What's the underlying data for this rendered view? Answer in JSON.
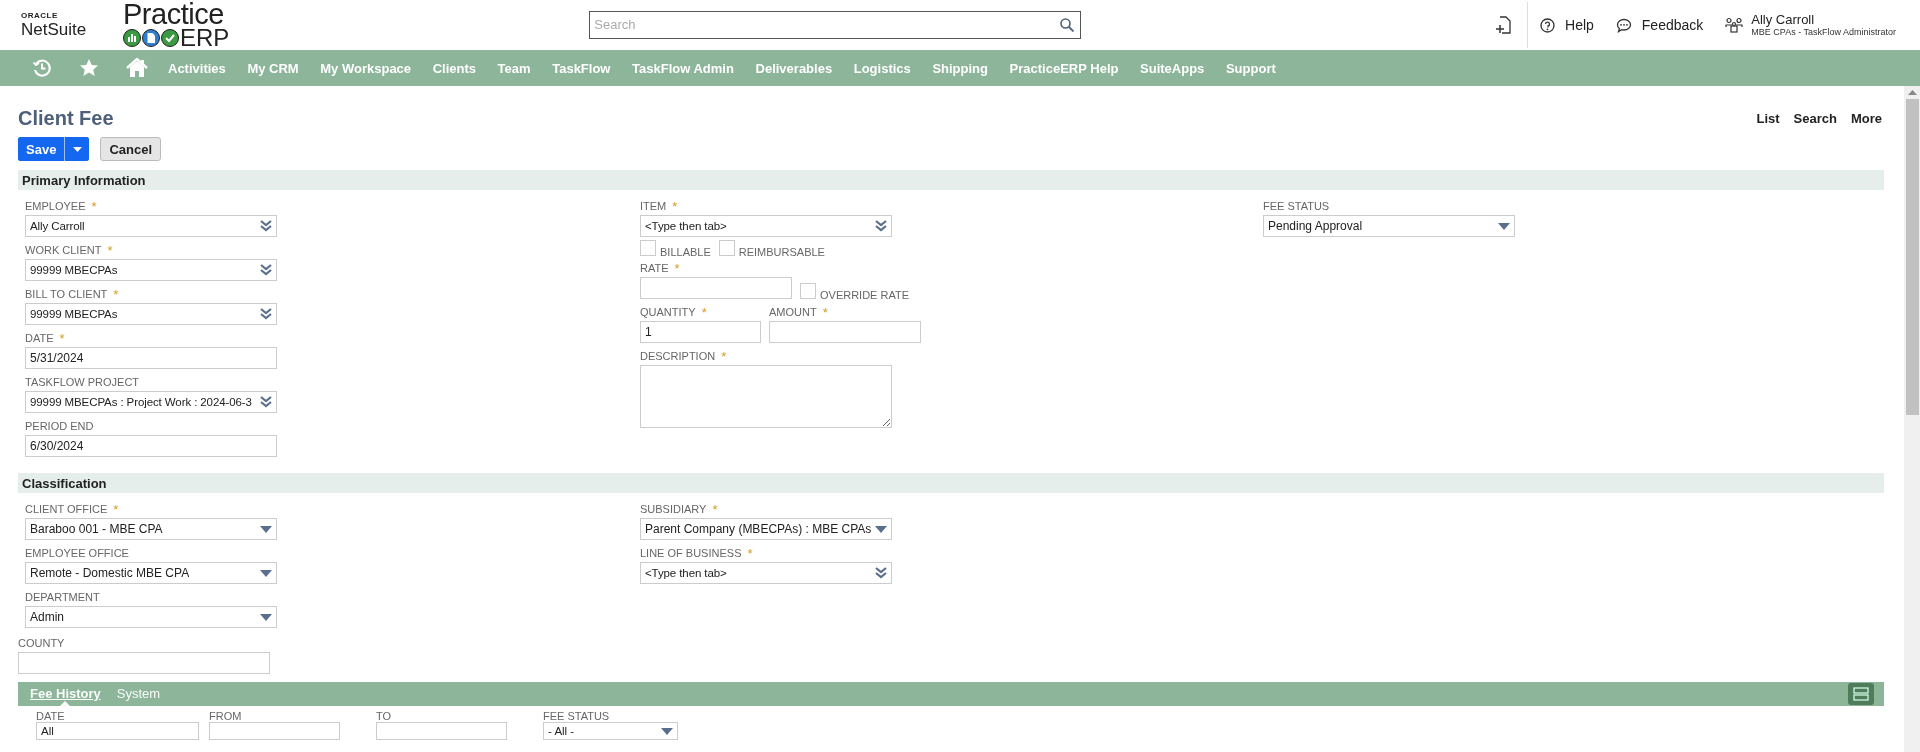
{
  "header": {
    "oracle_logo": {
      "top": "ORACLE",
      "bottom": "NetSuite"
    },
    "app_logo": {
      "first": "Practice",
      "second": "ERP"
    },
    "search": {
      "placeholder": "Search"
    },
    "links": [
      {
        "kind": "help",
        "label": "Help"
      },
      {
        "kind": "feedback",
        "label": "Feedback"
      }
    ],
    "user": {
      "name": "Ally Carroll",
      "role": "MBE CPAs - TaskFlow Administrator"
    }
  },
  "nav": {
    "icons": [
      {
        "kind": "recent"
      },
      {
        "kind": "star"
      },
      {
        "kind": "home"
      }
    ],
    "items": [
      "Activities",
      "My CRM",
      "My Workspace",
      "Clients",
      "Team",
      "TaskFlow",
      "TaskFlow Admin",
      "Deliverables",
      "Logistics",
      "Shipping",
      "PracticeERP Help",
      "SuiteApps",
      "Support"
    ]
  },
  "page": {
    "title": "Client Fee",
    "actions": [
      "List",
      "Search",
      "More"
    ],
    "buttons": {
      "save": "Save",
      "cancel": "Cancel"
    }
  },
  "sections": [
    {
      "title": "Primary Information",
      "columns": [
        [
          {
            "kind": "lookup",
            "label": "EMPLOYEE",
            "mark": "*",
            "value": "Ally Carroll"
          },
          {
            "kind": "lookup",
            "label": "WORK CLIENT",
            "mark": "*",
            "value": "99999 MBECPAs"
          },
          {
            "kind": "lookup",
            "label": "BILL TO CLIENT",
            "mark": "*",
            "value": "99999 MBECPAs"
          },
          {
            "kind": "text",
            "label": "DATE",
            "mark": "*",
            "value": "5/31/2024"
          },
          {
            "kind": "lookup",
            "label": "TASKFLOW PROJECT",
            "value": "99999 MBECPAs : Project Work : 2024-06-3"
          },
          {
            "kind": "text",
            "label": "PERIOD END",
            "value": "6/30/2024"
          }
        ],
        [
          {
            "kind": "lookup",
            "label": "ITEM",
            "mark": "*",
            "value": "<Type then tab>"
          },
          {
            "kind": "row",
            "fields": [
              {
                "kind": "checkbox",
                "label": "BILLABLE",
                "checked": false
              },
              {
                "kind": "checkbox",
                "label": "REIMBURSABLE",
                "checked": false
              }
            ]
          },
          {
            "kind": "row",
            "fields": [
              {
                "kind": "short",
                "label": "RATE",
                "mark": "*"
              },
              {
                "kind": "checkbox",
                "label": "OVERRIDE RATE",
                "checked": false
              }
            ]
          },
          {
            "kind": "row",
            "fields": [
              {
                "kind": "small",
                "label": "QUANTITY",
                "mark": "*",
                "value": "1"
              },
              {
                "kind": "short",
                "label": "AMOUNT",
                "mark": "*"
              }
            ]
          },
          {
            "kind": "textarea",
            "label": "DESCRIPTION",
            "mark": "*"
          }
        ],
        [
          {
            "kind": "select",
            "label": "FEE STATUS",
            "value": "Pending Approval"
          }
        ]
      ]
    },
    {
      "title": "Classification",
      "columns": [
        [
          {
            "kind": "select",
            "label": "CLIENT OFFICE",
            "mark": "*",
            "value": "Baraboo 001 - MBE CPA"
          },
          {
            "kind": "select",
            "label": "EMPLOYEE OFFICE",
            "value": "Remote - Domestic MBE CPA"
          },
          {
            "kind": "select",
            "label": "DEPARTMENT",
            "value": "Admin"
          }
        ],
        [
          {
            "kind": "select",
            "label": "SUBSIDIARY",
            "mark": "*",
            "value": "Parent Company (MBECPAs) : MBE CPAs"
          },
          {
            "kind": "lookup",
            "label": "LINE OF BUSINESS",
            "mark": "*",
            "value": "<Type then tab>"
          }
        ]
      ]
    }
  ],
  "county": {
    "kind": "text",
    "label": "COUNTY"
  },
  "subtabs": [
    {
      "label": "Fee History",
      "selected": true
    },
    {
      "label": "System",
      "selected": false
    }
  ],
  "filters": [
    {
      "kind": "text",
      "label": "DATE",
      "value": "All"
    },
    {
      "kind": "text",
      "label": "FROM"
    },
    {
      "kind": "text",
      "label": "TO"
    },
    {
      "kind": "select",
      "label": "FEE STATUS",
      "value": "- All -"
    }
  ]
}
